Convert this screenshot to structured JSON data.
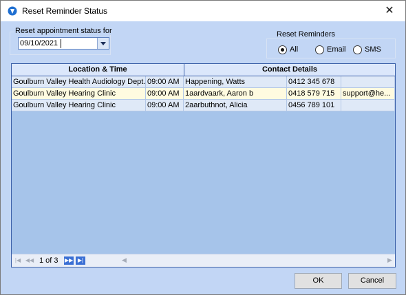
{
  "window": {
    "title": "Reset Reminder Status",
    "close_glyph": "✕"
  },
  "reset_status": {
    "label": "Reset appointment status for",
    "date_value": "09/10/2021"
  },
  "reset_reminders": {
    "label": "Reset Reminders",
    "options": [
      {
        "label": "All",
        "selected": true
      },
      {
        "label": "Email",
        "selected": false
      },
      {
        "label": "SMS",
        "selected": false
      }
    ]
  },
  "grid": {
    "groups": [
      "Location & Time",
      "Contact Details"
    ],
    "rows": [
      {
        "location": "Goulburn Valley Health Audiology Dept.",
        "time": "09:00 AM",
        "name": "Happening, Watts",
        "phone": "0412 345 678",
        "email": ""
      },
      {
        "location": "Goulburn Valley Hearing Clinic",
        "time": "09:00 AM",
        "name": "1aardvaark, Aaron b",
        "phone": "0418 579 715",
        "email": "support@he..."
      },
      {
        "location": "Goulburn Valley Hearing Clinic",
        "time": "09:00 AM",
        "name": "2aarbuthnot, Alicia",
        "phone": "0456 789 101",
        "email": ""
      }
    ],
    "pager": {
      "page_info": "1 of 3"
    }
  },
  "buttons": {
    "ok": "OK",
    "cancel": "Cancel"
  },
  "colors": {
    "background": "#c2d6f5",
    "grid_body": "#a6c4ea",
    "row_alt": "#dfe9f7",
    "row_highlight": "#fffbe0"
  }
}
